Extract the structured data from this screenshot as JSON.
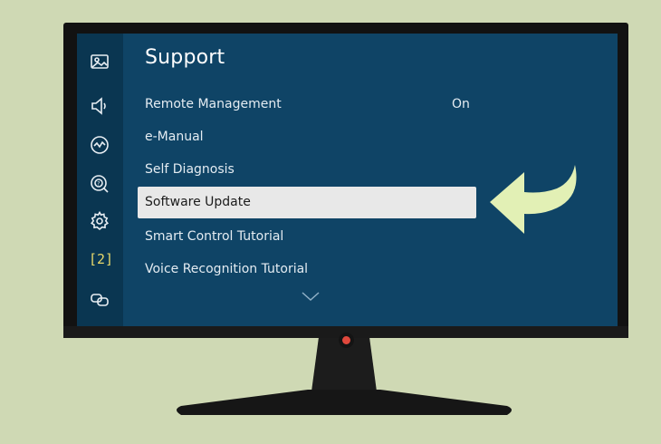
{
  "sidebar": {
    "icons": [
      "picture-icon",
      "sound-icon",
      "broadcast-icon",
      "support-icon",
      "settings-icon",
      "accessibility-icon",
      "connection-icon"
    ],
    "accessibility_label": "[2]"
  },
  "menu": {
    "title": "Support",
    "items": [
      {
        "label": "Remote Management",
        "value": "On"
      },
      {
        "label": "e-Manual",
        "value": ""
      },
      {
        "label": "Self Diagnosis",
        "value": ""
      },
      {
        "label": "Software Update",
        "value": ""
      },
      {
        "label": "Smart Control Tutorial",
        "value": ""
      },
      {
        "label": "Voice Recognition Tutorial",
        "value": ""
      }
    ],
    "selected": "Software Update"
  },
  "colors": {
    "background": "#cfd9b4",
    "screen": "#0f4466",
    "sidebar": "#0a3651",
    "selection": "#e8e8e8",
    "arrow": "#e2f0b5",
    "power_led": "#e0483c"
  }
}
